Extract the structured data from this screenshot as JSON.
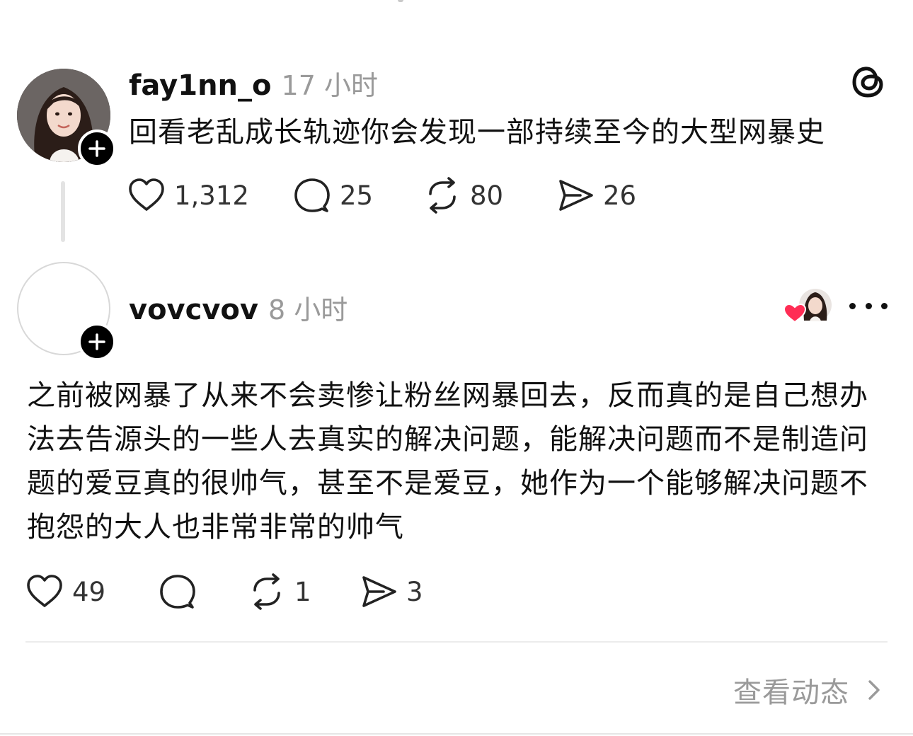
{
  "post1": {
    "username": "fay1nn_o",
    "time": "17 小时",
    "text": "回看老乱成长轨迹你会发现一部持续至今的大型网暴史",
    "likes": "1,312",
    "comments": "25",
    "reposts": "80",
    "shares": "26"
  },
  "post2": {
    "username": "vovcvov",
    "time": "8 小时",
    "text": "之前被网暴了从来不会卖惨让粉丝网暴回去，反而真的是自己想办法去告源头的一些人去真实的解决问题，能解决问题而不是制造问题的爱豆真的很帅气，甚至不是爱豆，她作为一个能够解决问题不抱怨的大人也非常非常的帅气",
    "likes": "49",
    "comments": "",
    "reposts": "1",
    "shares": "3"
  },
  "footer": {
    "view_activity": "查看动态"
  },
  "icons": {
    "threads_logo": "threads-logo-icon",
    "like": "heart-icon",
    "comment": "comment-bubble-icon",
    "repost": "repost-icon",
    "share": "send-icon",
    "more": "more-icon",
    "chevron": "chevron-right-icon"
  },
  "colors": {
    "text": "#111111",
    "muted": "#9a9a9a",
    "heart_red": "#ff2d55"
  }
}
